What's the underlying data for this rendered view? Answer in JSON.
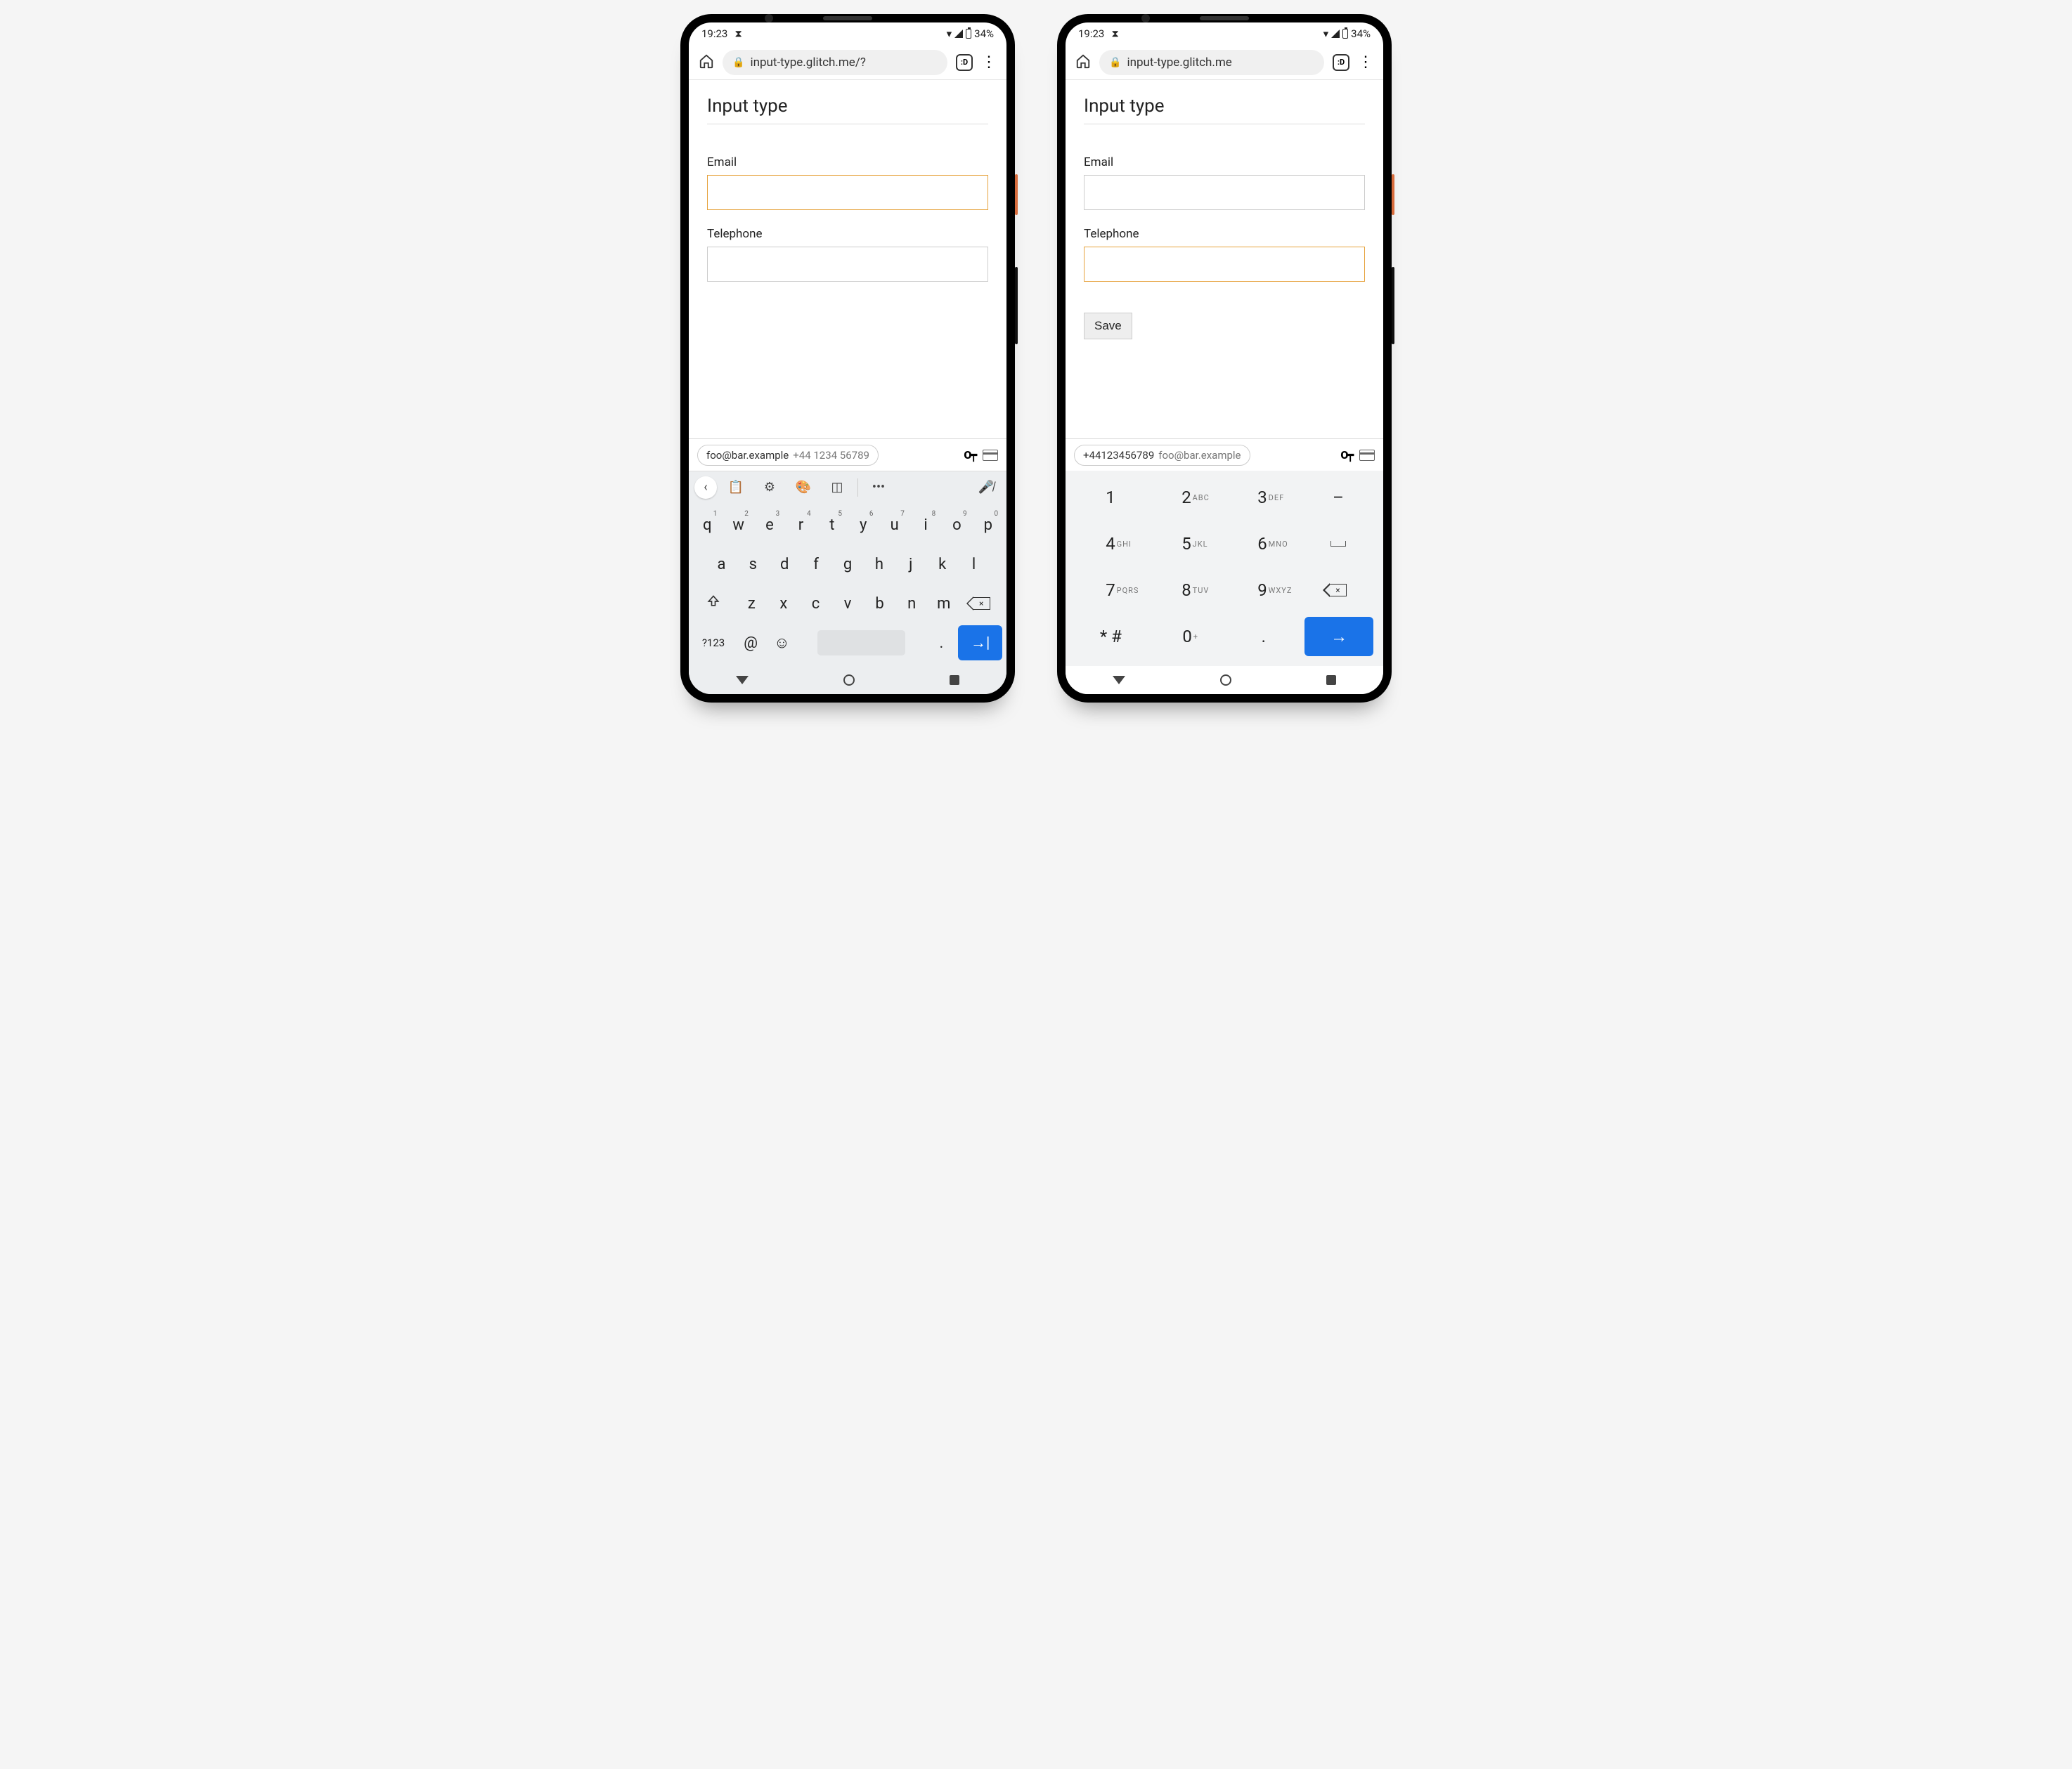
{
  "status": {
    "time": "19:23",
    "battery": "34%"
  },
  "browser": {
    "url_left": "input-type.glitch.me/?",
    "url_right": "input-type.glitch.me",
    "tab_badge": ":D"
  },
  "page": {
    "title": "Input type",
    "fields": {
      "email_label": "Email",
      "tel_label": "Telephone"
    },
    "save_label": "Save"
  },
  "suggest": {
    "left": {
      "primary": "foo@bar.example",
      "secondary": "+44 1234 56789"
    },
    "right": {
      "primary": "+44123456789",
      "secondary": "foo@bar.example"
    }
  },
  "qwerty": {
    "row1": [
      {
        "k": "q",
        "n": "1"
      },
      {
        "k": "w",
        "n": "2"
      },
      {
        "k": "e",
        "n": "3"
      },
      {
        "k": "r",
        "n": "4"
      },
      {
        "k": "t",
        "n": "5"
      },
      {
        "k": "y",
        "n": "6"
      },
      {
        "k": "u",
        "n": "7"
      },
      {
        "k": "i",
        "n": "8"
      },
      {
        "k": "o",
        "n": "9"
      },
      {
        "k": "p",
        "n": "0"
      }
    ],
    "row2": [
      "a",
      "s",
      "d",
      "f",
      "g",
      "h",
      "j",
      "k",
      "l"
    ],
    "row3": [
      "z",
      "x",
      "c",
      "v",
      "b",
      "n",
      "m"
    ],
    "symkey": "?123",
    "atkey": "@",
    "dotkey": "."
  },
  "numpad": {
    "rows": [
      [
        {
          "k": "1"
        },
        {
          "k": "2",
          "l": "ABC"
        },
        {
          "k": "3",
          "l": "DEF"
        },
        {
          "k": "–"
        }
      ],
      [
        {
          "k": "4",
          "l": "GHI"
        },
        {
          "k": "5",
          "l": "JKL"
        },
        {
          "k": "6",
          "l": "MNO"
        },
        {
          "k": "⎵"
        }
      ],
      [
        {
          "k": "7",
          "l": "PQRS"
        },
        {
          "k": "8",
          "l": "TUV"
        },
        {
          "k": "9",
          "l": "WXYZ"
        },
        {
          "k": "bksp"
        }
      ],
      [
        {
          "k": "* #"
        },
        {
          "k": "0",
          "l": "+"
        },
        {
          "k": "."
        },
        {
          "k": "enter"
        }
      ]
    ]
  }
}
